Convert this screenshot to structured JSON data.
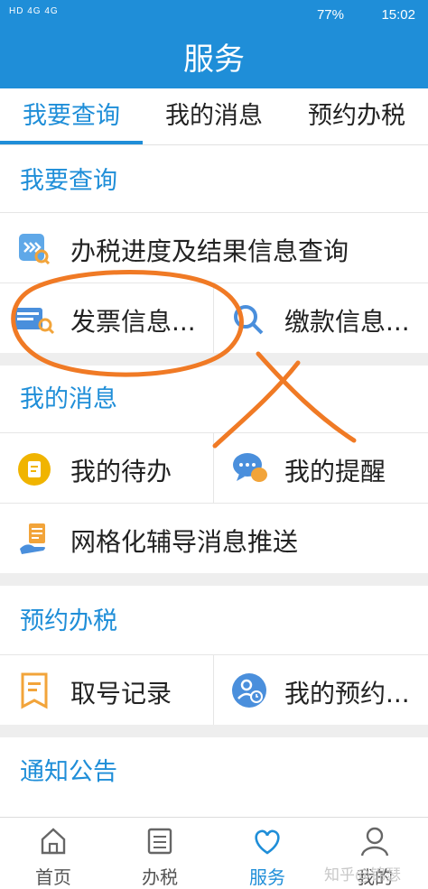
{
  "status": {
    "left_text": "HD 4G 4G",
    "battery_pct": "77%",
    "time": "15:02"
  },
  "title": "服务",
  "tabs": [
    "我要查询",
    "我的消息",
    "预约办税"
  ],
  "query": {
    "title": "我要查询",
    "progress": "办税进度及结果信息查询",
    "invoice": "发票信息...",
    "payment": "缴款信息..."
  },
  "messages": {
    "title": "我的消息",
    "todo": "我的待办",
    "reminder": "我的提醒",
    "push": "网格化辅导消息推送"
  },
  "appointment": {
    "title": "预约办税",
    "queue_record": "取号记录",
    "my_appointment": "我的预约..."
  },
  "notice": {
    "title": "通知公告"
  },
  "bottom_nav": [
    "首页",
    "办税",
    "服务",
    "我的"
  ],
  "watermark": "知乎@锦瑟",
  "colors": {
    "primary": "#1f8ed8",
    "annotation": "#f07a25"
  }
}
